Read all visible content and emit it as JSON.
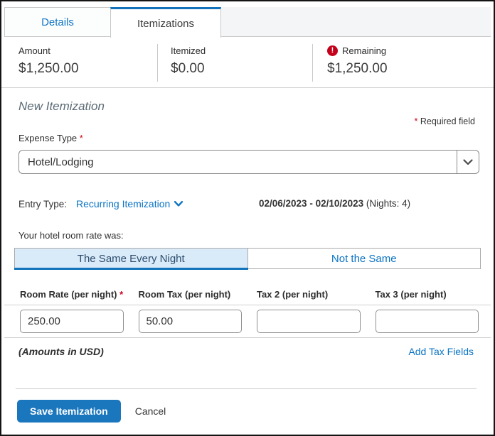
{
  "tabs": {
    "details": "Details",
    "itemizations": "Itemizations"
  },
  "summary": {
    "amount_label": "Amount",
    "amount_value": "$1,250.00",
    "itemized_label": "Itemized",
    "itemized_value": "$0.00",
    "remaining_label": "Remaining",
    "remaining_value": "$1,250.00"
  },
  "form": {
    "heading": "New Itemization",
    "required_star": "*",
    "required_note": "Required field",
    "expense_type": {
      "label": "Expense Type",
      "value": "Hotel/Lodging"
    },
    "entry_type": {
      "label": "Entry Type:",
      "value": "Recurring Itemization",
      "dates": "02/06/2023 - 02/10/2023",
      "nights": "(Nights: 4)"
    },
    "rate_question": "Your hotel room rate was:",
    "segments": {
      "same": "The Same Every Night",
      "not_same": "Not the Same"
    },
    "fields": [
      {
        "label": "Room Rate (per night)",
        "required": true,
        "value": "250.00"
      },
      {
        "label": "Room Tax (per night)",
        "required": false,
        "value": "50.00"
      },
      {
        "label": "Tax 2 (per night)",
        "required": false,
        "value": ""
      },
      {
        "label": "Tax 3 (per night)",
        "required": false,
        "value": ""
      }
    ],
    "amounts_note": "(Amounts in USD)",
    "add_tax_link": "Add Tax Fields"
  },
  "footer": {
    "save": "Save Itemization",
    "cancel": "Cancel"
  },
  "colors": {
    "accent_blue": "#1273ba",
    "link_blue": "#0b74c4",
    "selected_segment_bg": "#d9eaf8",
    "warning_red": "#c4001a",
    "required_red": "#d0021b",
    "save_button_bg": "#1a76bd"
  }
}
